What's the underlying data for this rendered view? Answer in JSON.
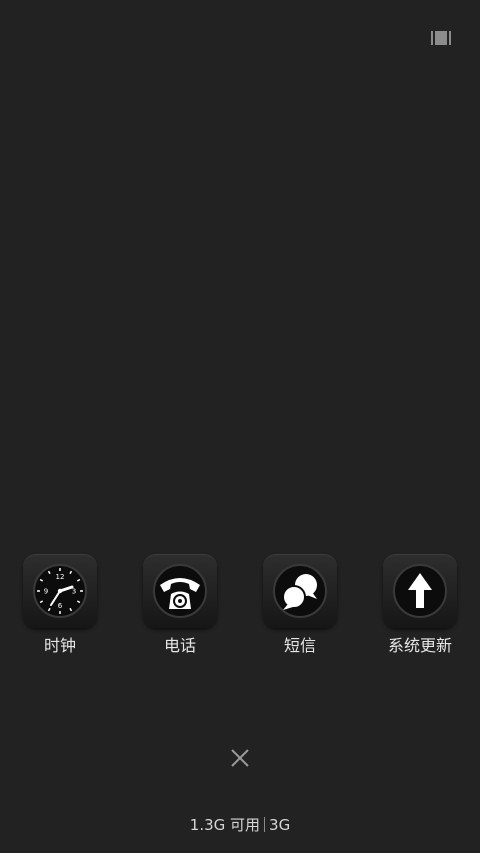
{
  "header": {
    "toggle_icon": "bars-toggle-icon"
  },
  "recent_apps": [
    {
      "label": "时钟",
      "icon": "clock-icon"
    },
    {
      "label": "电话",
      "icon": "phone-icon"
    },
    {
      "label": "短信",
      "icon": "messages-icon"
    },
    {
      "label": "系统更新",
      "icon": "update-arrow-icon"
    }
  ],
  "clock_face_numbers": [
    "12",
    "3",
    "6",
    "9"
  ],
  "footer": {
    "close_icon": "close-icon",
    "memory_available": "1.3G 可用",
    "memory_total": "3G"
  },
  "colors": {
    "background": "#222222",
    "icon_tile": "#1e1e1e",
    "text": "#e6e6e6"
  }
}
